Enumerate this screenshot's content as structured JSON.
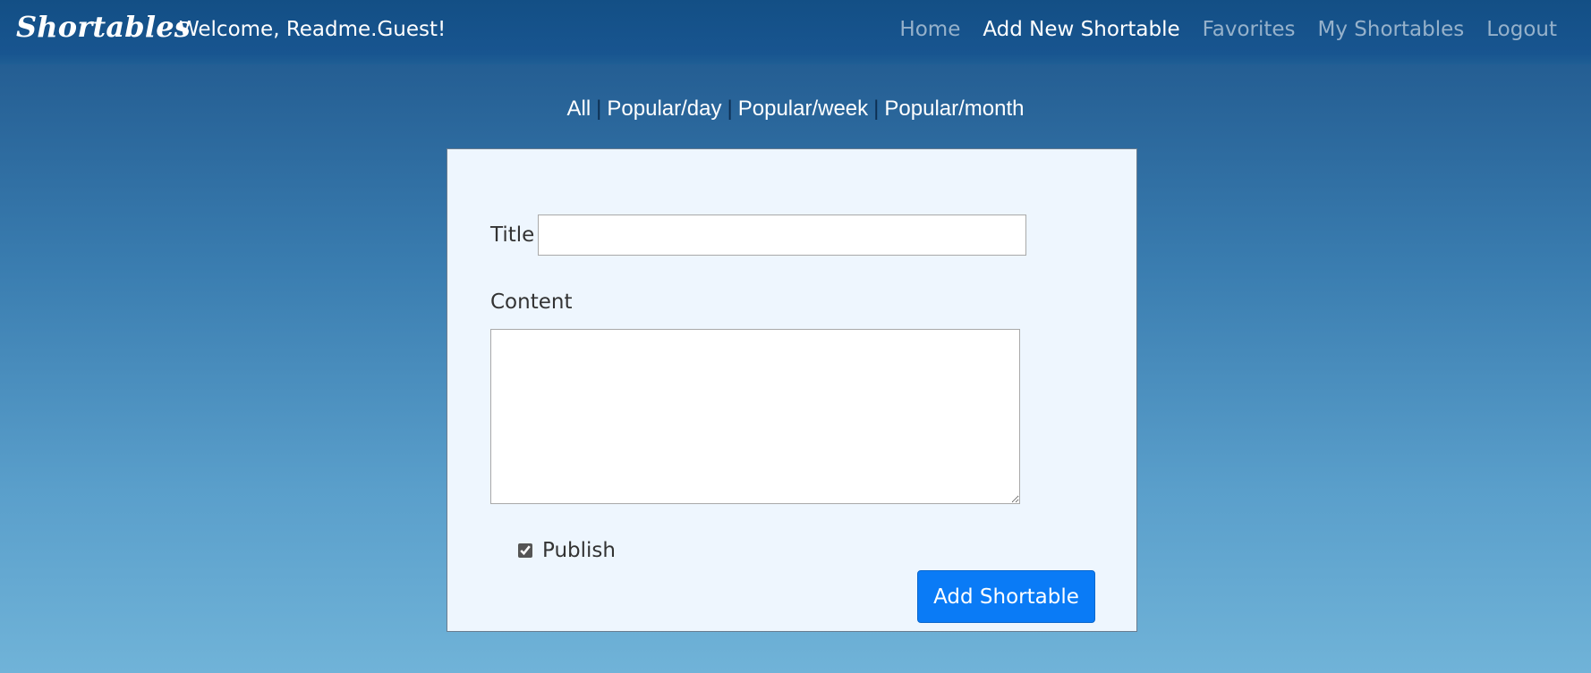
{
  "app": {
    "brand": "Shortables",
    "welcome": "Welcome, Readme.Guest!"
  },
  "nav": {
    "items": [
      {
        "label": "Home",
        "active": false
      },
      {
        "label": "Add New Shortable",
        "active": true
      },
      {
        "label": "Favorites",
        "active": false
      },
      {
        "label": "My Shortables",
        "active": false
      },
      {
        "label": "Logout",
        "active": false
      }
    ]
  },
  "filters": {
    "items": [
      {
        "label": "All"
      },
      {
        "label": "Popular/day"
      },
      {
        "label": "Popular/week"
      },
      {
        "label": "Popular/month"
      }
    ],
    "separator": "|"
  },
  "form": {
    "title_label": "Title",
    "title_value": "",
    "content_label": "Content",
    "content_value": "",
    "publish_label": "Publish",
    "publish_checked": true,
    "submit_label": "Add Shortable"
  },
  "colors": {
    "navbar": "#134f85",
    "card_background": "#eef6fe",
    "button": "#0a7bf6",
    "nav_inactive": "rgba(255,255,255,0.55)",
    "nav_active": "#ffffff"
  }
}
